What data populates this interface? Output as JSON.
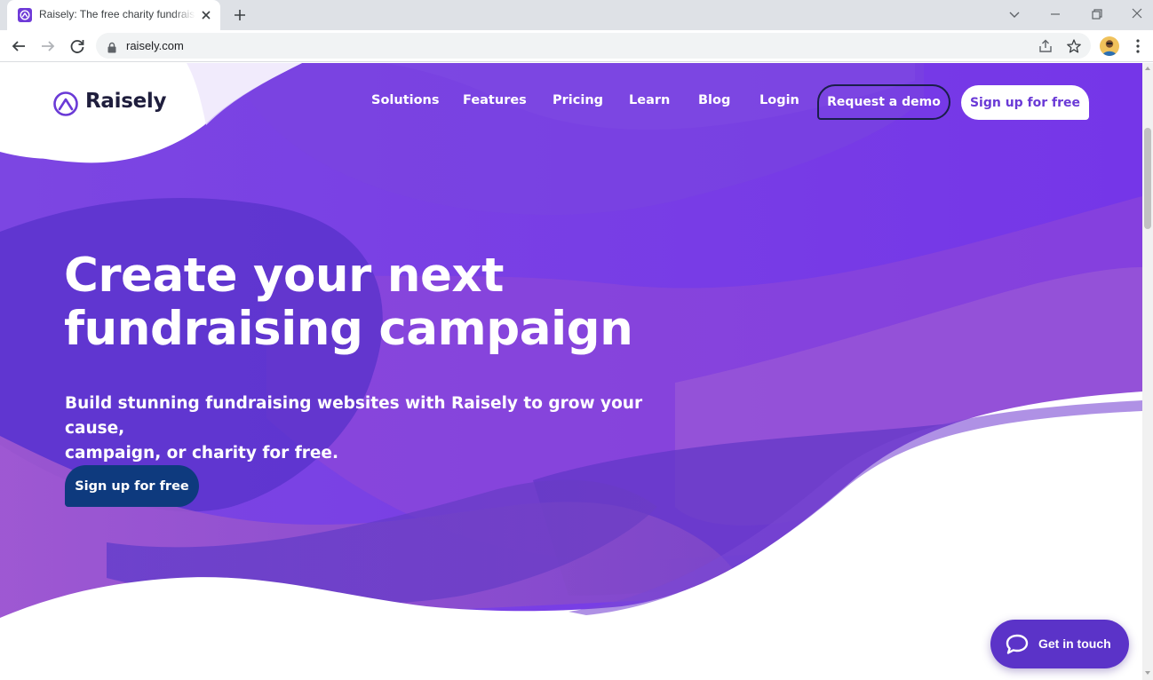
{
  "browser": {
    "tab_title": "Raisely: The free charity fundraising platform",
    "url": "raisely.com"
  },
  "site": {
    "logo_text": "Raisely",
    "nav": {
      "items": [
        {
          "label": "Solutions"
        },
        {
          "label": "Features"
        },
        {
          "label": "Pricing"
        },
        {
          "label": "Learn"
        },
        {
          "label": "Blog"
        },
        {
          "label": "Login"
        }
      ],
      "demo_button": "Request a demo",
      "signup_button": "Sign up for free"
    },
    "hero": {
      "headline_line1": "Create your next",
      "headline_line2": "fundraising campaign",
      "subheadline_line1": "Build stunning fundraising websites with Raisely to grow your cause,",
      "subheadline_line2": "campaign, or charity for free.",
      "cta": "Sign up for free"
    },
    "chat": {
      "label": "Get in touch"
    }
  },
  "colors": {
    "brand_purple": "#6a3ad6",
    "dark_navy": "#0e3a7e",
    "chat_purple": "#5b33c8"
  }
}
